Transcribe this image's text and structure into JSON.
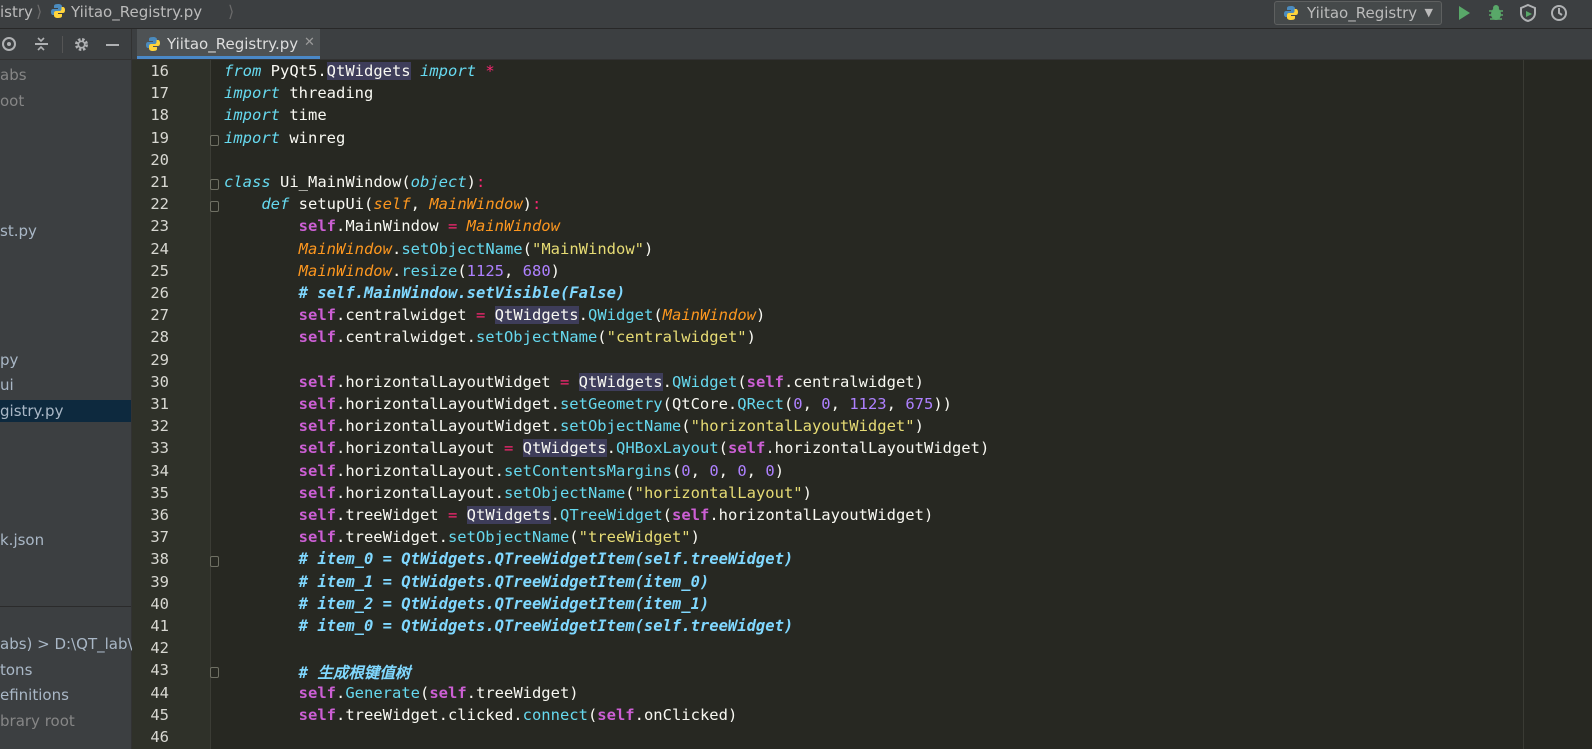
{
  "navbar": {
    "crumb_project": "istry",
    "crumb_file": "Yiitao_Registry.py",
    "run_config": "Yiitao_Registry"
  },
  "project_panel": {
    "items": [
      {
        "label": "abs",
        "dim": true
      },
      {
        "label": "oot",
        "dim": true
      },
      {
        "label": "st.py"
      },
      {
        "label": "py"
      },
      {
        "label": "ui"
      },
      {
        "label": "gistry.py",
        "selected": true
      },
      {
        "label": "k.json"
      },
      {
        "label": "abs) >  D:\\QT_lab\\L"
      },
      {
        "label": "tons"
      },
      {
        "label": "efinitions"
      },
      {
        "label": "brary root",
        "dim": true
      }
    ]
  },
  "editor": {
    "tab_label": "Yiitao_Registry.py",
    "line_numbers": [
      "16",
      "17",
      "18",
      "19",
      "20",
      "21",
      "22",
      "23",
      "24",
      "25",
      "26",
      "27",
      "28",
      "29",
      "30",
      "31",
      "32",
      "33",
      "34",
      "35",
      "36",
      "37",
      "38",
      "39",
      "40",
      "41",
      "42",
      "43",
      "44",
      "45",
      "46"
    ],
    "colors": {
      "background": "#272822",
      "gutter": "#2f3129",
      "keyword": "#66d9ef",
      "self": "#cc5fd4",
      "string": "#e6db74",
      "number": "#ae81ff",
      "operator": "#f92672",
      "param": "#fd971f",
      "comment": "#80d8ff"
    },
    "lines": [
      [
        [
          "kw",
          "from"
        ],
        [
          "t",
          " PyQt5."
        ],
        [
          "hl",
          "QtWidgets"
        ],
        [
          "t",
          " "
        ],
        [
          "kw",
          "import"
        ],
        [
          "t",
          " "
        ],
        [
          "op",
          "*"
        ]
      ],
      [
        [
          "kw",
          "import"
        ],
        [
          "t",
          " threading"
        ]
      ],
      [
        [
          "kw",
          "import"
        ],
        [
          "t",
          " time"
        ]
      ],
      [
        [
          "kw",
          "import"
        ],
        [
          "t",
          " winreg"
        ]
      ],
      [],
      [
        [
          "kw",
          "class"
        ],
        [
          "t",
          " Ui_MainWindow("
        ],
        [
          "dim-cls",
          "object"
        ],
        [
          "t",
          ")"
        ],
        [
          "op",
          ":"
        ]
      ],
      [
        [
          "t",
          "    "
        ],
        [
          "kw",
          "def"
        ],
        [
          "t",
          " setupUi("
        ],
        [
          "param",
          "self"
        ],
        [
          "t",
          ", "
        ],
        [
          "param",
          "MainWindow"
        ],
        [
          "t",
          ")"
        ],
        [
          "op",
          ":"
        ]
      ],
      [
        [
          "t",
          "        "
        ],
        [
          "self",
          "self"
        ],
        [
          "t",
          ".MainWindow "
        ],
        [
          "op",
          "="
        ],
        [
          "t",
          " "
        ],
        [
          "param",
          "MainWindow"
        ]
      ],
      [
        [
          "t",
          "        "
        ],
        [
          "param",
          "MainWindow"
        ],
        [
          "t",
          "."
        ],
        [
          "fn",
          "setObjectName"
        ],
        [
          "t",
          "("
        ],
        [
          "str",
          "\"MainWindow\""
        ],
        [
          "t",
          ")"
        ]
      ],
      [
        [
          "t",
          "        "
        ],
        [
          "param",
          "MainWindow"
        ],
        [
          "t",
          "."
        ],
        [
          "fn",
          "resize"
        ],
        [
          "t",
          "("
        ],
        [
          "num",
          "1125"
        ],
        [
          "t",
          ", "
        ],
        [
          "num",
          "680"
        ],
        [
          "t",
          ")"
        ]
      ],
      [
        [
          "t",
          "        "
        ],
        [
          "cmt",
          "# self.MainWindow.setVisible(False)"
        ]
      ],
      [
        [
          "t",
          "        "
        ],
        [
          "self",
          "self"
        ],
        [
          "t",
          ".centralwidget "
        ],
        [
          "op",
          "="
        ],
        [
          "t",
          " "
        ],
        [
          "hl",
          "QtWidgets"
        ],
        [
          "t",
          "."
        ],
        [
          "fn",
          "QWidget"
        ],
        [
          "t",
          "("
        ],
        [
          "param",
          "MainWindow"
        ],
        [
          "t",
          ")"
        ]
      ],
      [
        [
          "t",
          "        "
        ],
        [
          "self",
          "self"
        ],
        [
          "t",
          ".centralwidget."
        ],
        [
          "fn",
          "setObjectName"
        ],
        [
          "t",
          "("
        ],
        [
          "str",
          "\"centralwidget\""
        ],
        [
          "t",
          ")"
        ]
      ],
      [],
      [
        [
          "t",
          "        "
        ],
        [
          "self",
          "self"
        ],
        [
          "t",
          ".horizontalLayoutWidget "
        ],
        [
          "op",
          "="
        ],
        [
          "t",
          " "
        ],
        [
          "hl",
          "QtWidgets"
        ],
        [
          "t",
          "."
        ],
        [
          "fn",
          "QWidget"
        ],
        [
          "t",
          "("
        ],
        [
          "self",
          "self"
        ],
        [
          "t",
          ".centralwidget)"
        ]
      ],
      [
        [
          "t",
          "        "
        ],
        [
          "self",
          "self"
        ],
        [
          "t",
          ".horizontalLayoutWidget."
        ],
        [
          "fn",
          "setGeometry"
        ],
        [
          "t",
          "(QtCore."
        ],
        [
          "fn",
          "QRect"
        ],
        [
          "t",
          "("
        ],
        [
          "num",
          "0"
        ],
        [
          "t",
          ", "
        ],
        [
          "num",
          "0"
        ],
        [
          "t",
          ", "
        ],
        [
          "num",
          "1123"
        ],
        [
          "t",
          ", "
        ],
        [
          "num",
          "675"
        ],
        [
          "t",
          "))"
        ]
      ],
      [
        [
          "t",
          "        "
        ],
        [
          "self",
          "self"
        ],
        [
          "t",
          ".horizontalLayoutWidget."
        ],
        [
          "fn",
          "setObjectName"
        ],
        [
          "t",
          "("
        ],
        [
          "str",
          "\"horizontalLayoutWidget\""
        ],
        [
          "t",
          ")"
        ]
      ],
      [
        [
          "t",
          "        "
        ],
        [
          "self",
          "self"
        ],
        [
          "t",
          ".horizontalLayout "
        ],
        [
          "op",
          "="
        ],
        [
          "t",
          " "
        ],
        [
          "hl",
          "QtWidgets"
        ],
        [
          "t",
          "."
        ],
        [
          "fn",
          "QHBoxLayout"
        ],
        [
          "t",
          "("
        ],
        [
          "self",
          "self"
        ],
        [
          "t",
          ".horizontalLayoutWidget)"
        ]
      ],
      [
        [
          "t",
          "        "
        ],
        [
          "self",
          "self"
        ],
        [
          "t",
          ".horizontalLayout."
        ],
        [
          "fn",
          "setContentsMargins"
        ],
        [
          "t",
          "("
        ],
        [
          "num",
          "0"
        ],
        [
          "t",
          ", "
        ],
        [
          "num",
          "0"
        ],
        [
          "t",
          ", "
        ],
        [
          "num",
          "0"
        ],
        [
          "t",
          ", "
        ],
        [
          "num",
          "0"
        ],
        [
          "t",
          ")"
        ]
      ],
      [
        [
          "t",
          "        "
        ],
        [
          "self",
          "self"
        ],
        [
          "t",
          ".horizontalLayout."
        ],
        [
          "fn",
          "setObjectName"
        ],
        [
          "t",
          "("
        ],
        [
          "str",
          "\"horizontalLayout\""
        ],
        [
          "t",
          ")"
        ]
      ],
      [
        [
          "t",
          "        "
        ],
        [
          "self",
          "self"
        ],
        [
          "t",
          ".treeWidget "
        ],
        [
          "op",
          "="
        ],
        [
          "t",
          " "
        ],
        [
          "hl",
          "QtWidgets"
        ],
        [
          "t",
          "."
        ],
        [
          "fn",
          "QTreeWidget"
        ],
        [
          "t",
          "("
        ],
        [
          "self",
          "self"
        ],
        [
          "t",
          ".horizontalLayoutWidget)"
        ]
      ],
      [
        [
          "t",
          "        "
        ],
        [
          "self",
          "self"
        ],
        [
          "t",
          ".treeWidget."
        ],
        [
          "fn",
          "setObjectName"
        ],
        [
          "t",
          "("
        ],
        [
          "str",
          "\"treeWidget\""
        ],
        [
          "t",
          ")"
        ]
      ],
      [
        [
          "t",
          "        "
        ],
        [
          "cmt",
          "# item_0 = QtWidgets.QTreeWidgetItem(self.treeWidget)"
        ]
      ],
      [
        [
          "t",
          "        "
        ],
        [
          "cmt",
          "# item_1 = QtWidgets.QTreeWidgetItem(item_0)"
        ]
      ],
      [
        [
          "t",
          "        "
        ],
        [
          "cmt",
          "# item_2 = QtWidgets.QTreeWidgetItem(item_1)"
        ]
      ],
      [
        [
          "t",
          "        "
        ],
        [
          "cmt",
          "# item_0 = QtWidgets.QTreeWidgetItem(self.treeWidget)"
        ]
      ],
      [],
      [
        [
          "t",
          "        "
        ],
        [
          "cmt",
          "# 生成根键值树"
        ]
      ],
      [
        [
          "t",
          "        "
        ],
        [
          "self",
          "self"
        ],
        [
          "t",
          "."
        ],
        [
          "fn",
          "Generate"
        ],
        [
          "t",
          "("
        ],
        [
          "self",
          "self"
        ],
        [
          "t",
          ".treeWidget)"
        ]
      ],
      [
        [
          "t",
          "        "
        ],
        [
          "self",
          "self"
        ],
        [
          "t",
          ".treeWidget.clicked."
        ],
        [
          "fn",
          "connect"
        ],
        [
          "t",
          "("
        ],
        [
          "self",
          "self"
        ],
        [
          "t",
          ".onClicked)"
        ]
      ],
      []
    ]
  }
}
